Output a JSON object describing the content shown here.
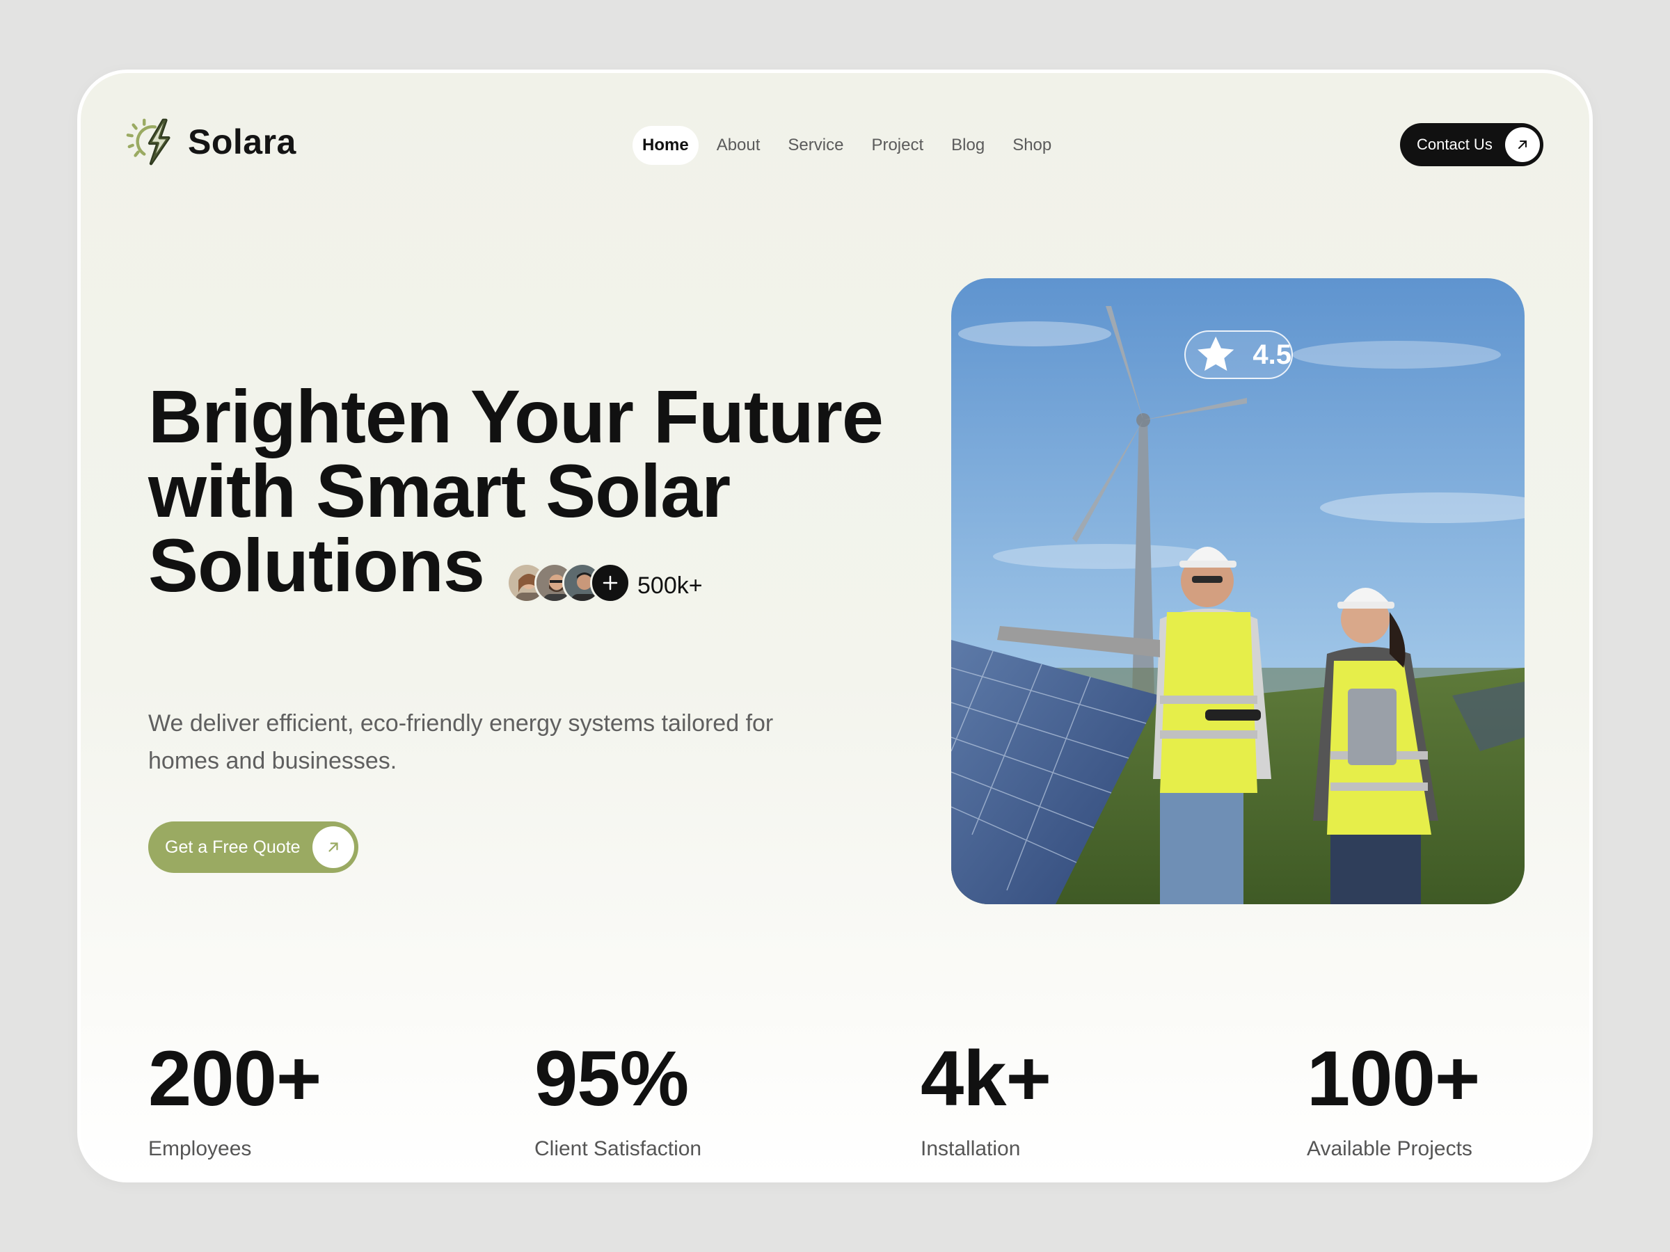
{
  "brand": {
    "name": "Solara",
    "accent": "#9aaa62",
    "dark": "#111111"
  },
  "nav": {
    "items": [
      {
        "label": "Home",
        "active": true
      },
      {
        "label": "About"
      },
      {
        "label": "Service"
      },
      {
        "label": "Project"
      },
      {
        "label": "Blog"
      },
      {
        "label": "Shop"
      }
    ]
  },
  "header": {
    "contact_label": "Contact Us"
  },
  "hero": {
    "title_lines": [
      "Brighten Your Future",
      "with Smart Solar",
      "Solutions"
    ],
    "customers_count": "500k+",
    "subtitle_lines": [
      "We deliver efficient, eco-friendly energy systems tailored for",
      "homes and businesses."
    ],
    "cta_label": "Get a Free Quote"
  },
  "photo": {
    "rating": "4.5",
    "rating_icon": "star-icon"
  },
  "stats": [
    {
      "value": "200+",
      "label": "Employees"
    },
    {
      "value": "95%",
      "label": "Client Satisfaction"
    },
    {
      "value": "4k+",
      "label": "Installation"
    },
    {
      "value": "100+",
      "label": "Available Projects"
    }
  ]
}
